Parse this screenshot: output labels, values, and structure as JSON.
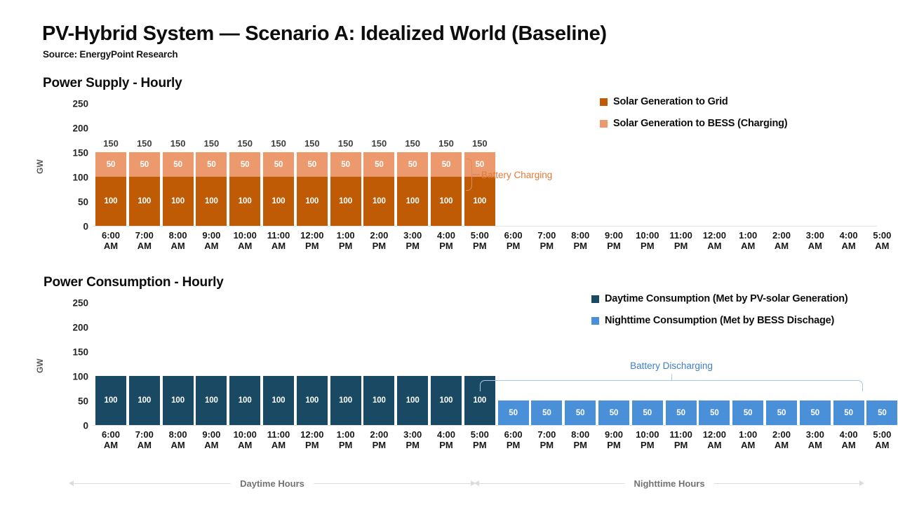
{
  "header": {
    "title": "PV-Hybrid System — Scenario A: Idealized World (Baseline)",
    "source": "Source: EnergyPoint Research"
  },
  "colors": {
    "solar_to_grid": "#BF5B04",
    "solar_to_bess": "#EC9A6D",
    "daytime_consumption": "#1A4A63",
    "nighttime_consumption": "#4A90D9",
    "charging_annotation": "#E07B39",
    "discharging_annotation": "#3E7FC6",
    "axis_text": "#171717",
    "range_text": "#737373"
  },
  "supply": {
    "panel_title": "Power Supply - Hourly",
    "legend": [
      {
        "label": "Solar Generation to Grid",
        "color": "#BF5B04",
        "name": "solar-to-grid"
      },
      {
        "label": "Solar Generation to BESS (Charging)",
        "color": "#EC9A6D",
        "name": "solar-to-bess"
      }
    ],
    "annotation": {
      "label": "Battery Charging"
    }
  },
  "consumption": {
    "panel_title": "Power Consumption - Hourly",
    "legend": [
      {
        "label": "Daytime Consumption (Met by PV-solar Generation)",
        "color": "#1A4A63",
        "name": "daytime-consumption"
      },
      {
        "label": "Nighttime Consumption (Met by BESS Dischage)",
        "color": "#4A90D9",
        "name": "nighttime-consumption"
      }
    ],
    "annotation": {
      "label": "Battery Discharging"
    }
  },
  "footer": {
    "daytime_label": "Daytime Hours",
    "nighttime_label": "Nighttime Hours"
  },
  "chart_data": [
    {
      "type": "bar",
      "id": "power-supply-hourly",
      "title": "Power Supply - Hourly",
      "stacked": true,
      "ylabel": "GW",
      "xlabel": "",
      "ylim": [
        0,
        250
      ],
      "yticks": [
        0,
        50,
        100,
        150,
        200,
        250
      ],
      "grid": false,
      "legend_position": "top-right",
      "categories": [
        "6:00 AM",
        "7:00 AM",
        "8:00 AM",
        "9:00 AM",
        "10:00 AM",
        "11:00 AM",
        "12:00 PM",
        "1:00 PM",
        "2:00 PM",
        "3:00 PM",
        "4:00 PM",
        "5:00 PM",
        "6:00 PM",
        "7:00 PM",
        "8:00 PM",
        "9:00 PM",
        "10:00 PM",
        "11:00 PM",
        "12:00 AM",
        "1:00 AM",
        "2:00 AM",
        "3:00 AM",
        "4:00 AM",
        "5:00 AM"
      ],
      "series": [
        {
          "name": "Solar Generation to Grid",
          "color": "#BF5B04",
          "values": [
            100,
            100,
            100,
            100,
            100,
            100,
            100,
            100,
            100,
            100,
            100,
            100,
            0,
            0,
            0,
            0,
            0,
            0,
            0,
            0,
            0,
            0,
            0,
            0
          ]
        },
        {
          "name": "Solar Generation to BESS (Charging)",
          "color": "#EC9A6D",
          "values": [
            50,
            50,
            50,
            50,
            50,
            50,
            50,
            50,
            50,
            50,
            50,
            50,
            0,
            0,
            0,
            0,
            0,
            0,
            0,
            0,
            0,
            0,
            0,
            0
          ]
        }
      ],
      "totals": [
        150,
        150,
        150,
        150,
        150,
        150,
        150,
        150,
        150,
        150,
        150,
        150,
        0,
        0,
        0,
        0,
        0,
        0,
        0,
        0,
        0,
        0,
        0,
        0
      ],
      "annotations": [
        {
          "text": "Battery Charging",
          "target": "Solar Generation to BESS (Charging)",
          "color": "#E07B39"
        }
      ]
    },
    {
      "type": "bar",
      "id": "power-consumption-hourly",
      "title": "Power Consumption - Hourly",
      "stacked": true,
      "ylabel": "GW",
      "xlabel": "",
      "ylim": [
        0,
        250
      ],
      "yticks": [
        0,
        50,
        100,
        150,
        200,
        250
      ],
      "grid": false,
      "legend_position": "top-right",
      "categories": [
        "6:00 AM",
        "7:00 AM",
        "8:00 AM",
        "9:00 AM",
        "10:00 AM",
        "11:00 AM",
        "12:00 PM",
        "1:00 PM",
        "2:00 PM",
        "3:00 PM",
        "4:00 PM",
        "5:00 PM",
        "6:00 PM",
        "7:00 PM",
        "8:00 PM",
        "9:00 PM",
        "10:00 PM",
        "11:00 PM",
        "12:00 AM",
        "1:00 AM",
        "2:00 AM",
        "3:00 AM",
        "4:00 AM",
        "5:00 AM"
      ],
      "series": [
        {
          "name": "Daytime Consumption (Met by PV-solar Generation)",
          "color": "#1A4A63",
          "values": [
            100,
            100,
            100,
            100,
            100,
            100,
            100,
            100,
            100,
            100,
            100,
            100,
            0,
            0,
            0,
            0,
            0,
            0,
            0,
            0,
            0,
            0,
            0,
            0
          ]
        },
        {
          "name": "Nighttime Consumption (Met by BESS Dischage)",
          "color": "#4A90D9",
          "values": [
            0,
            0,
            0,
            0,
            0,
            0,
            0,
            0,
            0,
            0,
            0,
            0,
            50,
            50,
            50,
            50,
            50,
            50,
            50,
            50,
            50,
            50,
            50,
            50
          ]
        }
      ],
      "totals": [
        100,
        100,
        100,
        100,
        100,
        100,
        100,
        100,
        100,
        100,
        100,
        100,
        50,
        50,
        50,
        50,
        50,
        50,
        50,
        50,
        50,
        50,
        50,
        50
      ],
      "annotations": [
        {
          "text": "Battery Discharging",
          "span": [
            "6:00 PM",
            "5:00 AM"
          ],
          "color": "#3E7FC6"
        }
      ]
    }
  ]
}
